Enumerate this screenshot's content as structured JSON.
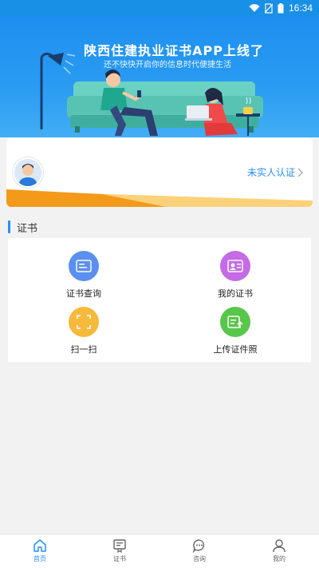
{
  "status_bar": {
    "time": "16:34"
  },
  "banner": {
    "title": "陕西住建执业证书APP上线了",
    "subtitle": "还不快快开启你的信息时代便捷生活"
  },
  "user_card": {
    "verify_label": "未实人认证"
  },
  "section": {
    "title": "证书"
  },
  "grid": [
    {
      "label": "证书查询",
      "icon": "certificate-search-icon",
      "color": "#5b8ff0"
    },
    {
      "label": "我的证书",
      "icon": "my-certificate-icon",
      "color": "#c56be6"
    },
    {
      "label": "扫一扫",
      "icon": "scan-icon",
      "color": "#f6b93b"
    },
    {
      "label": "上传证件照",
      "icon": "upload-photo-icon",
      "color": "#58c64a"
    }
  ],
  "nav": [
    {
      "label": "首页",
      "icon": "home-icon",
      "active": true
    },
    {
      "label": "证书",
      "icon": "certificate-icon",
      "active": false
    },
    {
      "label": "咨询",
      "icon": "chat-icon",
      "active": false
    },
    {
      "label": "我的",
      "icon": "person-icon",
      "active": false
    }
  ],
  "colors": {
    "primary": "#2a8ff0",
    "banner": "#1e8ff0",
    "accent_orange": "#f39a1a"
  }
}
